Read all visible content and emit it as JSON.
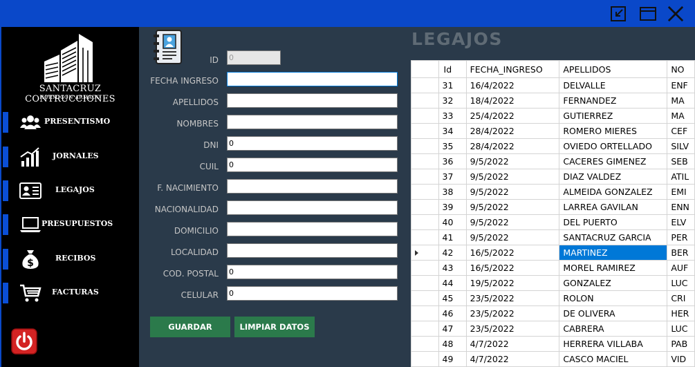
{
  "window": {
    "controls": [
      "restore-icon",
      "maximize-icon",
      "close-icon"
    ]
  },
  "sidebar": {
    "brand_name": "SANTACRUZ CONTRUCCIONES",
    "brand_sub": "HORMIGON ARMADO",
    "items": [
      {
        "label": "PRESENTISMO",
        "icon": "people-icon"
      },
      {
        "label": "JORNALES",
        "icon": "chart-icon"
      },
      {
        "label": "LEGAJOS",
        "icon": "id-card-icon"
      },
      {
        "label": "PRESUPUESTOS",
        "icon": "laptop-icon"
      },
      {
        "label": "RECIBOS",
        "icon": "money-bag-icon"
      },
      {
        "label": "FACTURAS",
        "icon": "cart-icon"
      }
    ],
    "power_icon": "power-icon"
  },
  "form": {
    "fields": [
      {
        "label": "ID",
        "value": "0"
      },
      {
        "label": "FECHA INGRESO",
        "value": ""
      },
      {
        "label": "APELLIDOS",
        "value": ""
      },
      {
        "label": "NOMBRES",
        "value": ""
      },
      {
        "label": "DNI",
        "value": "0"
      },
      {
        "label": "CUIL",
        "value": "0"
      },
      {
        "label": "F. NACIMIENTO",
        "value": ""
      },
      {
        "label": "NACIONALIDAD",
        "value": ""
      },
      {
        "label": "DOMICILIO",
        "value": ""
      },
      {
        "label": "LOCALIDAD",
        "value": ""
      },
      {
        "label": "COD. POSTAL",
        "value": "0"
      },
      {
        "label": "CELULAR",
        "value": "0"
      }
    ],
    "save_label": "GUARDAR",
    "clear_label": "LIMPIAR DATOS"
  },
  "main": {
    "title": "LEGAJOS",
    "columns": [
      "Id",
      "FECHA_INGRESO",
      "APELLIDOS",
      "NO"
    ],
    "rows": [
      {
        "id": "31",
        "fecha": "16/4/2022",
        "apellidos": "DELVALLE",
        "nombres": "ENF"
      },
      {
        "id": "32",
        "fecha": "18/4/2022",
        "apellidos": "FERNANDEZ",
        "nombres": "MA"
      },
      {
        "id": "33",
        "fecha": "25/4/2022",
        "apellidos": "GUTIERREZ",
        "nombres": "MA"
      },
      {
        "id": "34",
        "fecha": "28/4/2022",
        "apellidos": "ROMERO MIERES",
        "nombres": "CEF"
      },
      {
        "id": "35",
        "fecha": "28/4/2022",
        "apellidos": "OVIEDO ORTELLADO",
        "nombres": "SILV"
      },
      {
        "id": "36",
        "fecha": "9/5/2022",
        "apellidos": "CACERES GIMENEZ",
        "nombres": "SEB"
      },
      {
        "id": "37",
        "fecha": "9/5/2022",
        "apellidos": "DIAZ VALDEZ",
        "nombres": "ATIL"
      },
      {
        "id": "38",
        "fecha": "9/5/2022",
        "apellidos": "ALMEIDA GONZALEZ",
        "nombres": "EMI"
      },
      {
        "id": "39",
        "fecha": "9/5/2022",
        "apellidos": "LARREA GAVILAN",
        "nombres": "ENN"
      },
      {
        "id": "40",
        "fecha": "9/5/2022",
        "apellidos": "DEL PUERTO",
        "nombres": "ELV"
      },
      {
        "id": "41",
        "fecha": "9/5/2022",
        "apellidos": "SANTACRUZ GARCIA",
        "nombres": "PER"
      },
      {
        "id": "42",
        "fecha": "16/5/2022",
        "apellidos": "MARTINEZ",
        "nombres": "BER",
        "selected": true
      },
      {
        "id": "43",
        "fecha": "16/5/2022",
        "apellidos": "MOREL RAMIREZ",
        "nombres": "AUF"
      },
      {
        "id": "44",
        "fecha": "19/5/2022",
        "apellidos": "GONZALEZ",
        "nombres": "LUC"
      },
      {
        "id": "45",
        "fecha": "23/5/2022",
        "apellidos": "ROLON",
        "nombres": "CRI"
      },
      {
        "id": "46",
        "fecha": "23/5/2022",
        "apellidos": "DE OLIVERA",
        "nombres": "HER"
      },
      {
        "id": "47",
        "fecha": "23/5/2022",
        "apellidos": "CABRERA",
        "nombres": "LUC"
      },
      {
        "id": "48",
        "fecha": "4/7/2022",
        "apellidos": "HERRERA VILLABA",
        "nombres": "PAB"
      },
      {
        "id": "49",
        "fecha": "4/7/2022",
        "apellidos": "CASCO MACIEL",
        "nombres": "VID"
      }
    ]
  },
  "colors": {
    "titlebar": "#0a48c9",
    "sidebar": "#000000",
    "panel": "#2a3a4a",
    "button": "#2b7a4b",
    "selection": "#0078d7",
    "accent_bar": "#0b4fd6"
  }
}
